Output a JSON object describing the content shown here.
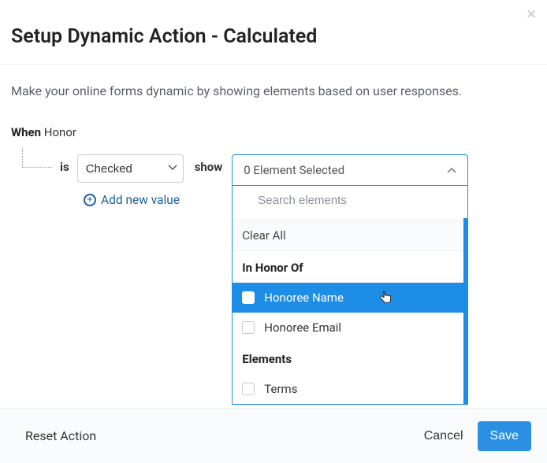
{
  "header": {
    "title": "Setup Dynamic Action - Calculated"
  },
  "body": {
    "description": "Make your online forms dynamic by showing elements based on user responses.",
    "when_label": "When",
    "when_field": "Honor",
    "is_label": "is",
    "condition_value": "Checked",
    "show_label": "show",
    "add_value_label": "Add new value"
  },
  "dropdown": {
    "summary": "0 Element Selected",
    "search_placeholder": "Search elements",
    "clear_label": "Clear All",
    "groups": [
      {
        "heading": "In Honor Of",
        "items": [
          {
            "label": "Honoree Name",
            "highlight": true
          },
          {
            "label": "Honoree Email",
            "highlight": false
          }
        ]
      },
      {
        "heading": "Elements",
        "items": [
          {
            "label": "Terms",
            "highlight": false
          }
        ]
      }
    ]
  },
  "footer": {
    "reset": "Reset Action",
    "cancel": "Cancel",
    "save": "Save"
  }
}
